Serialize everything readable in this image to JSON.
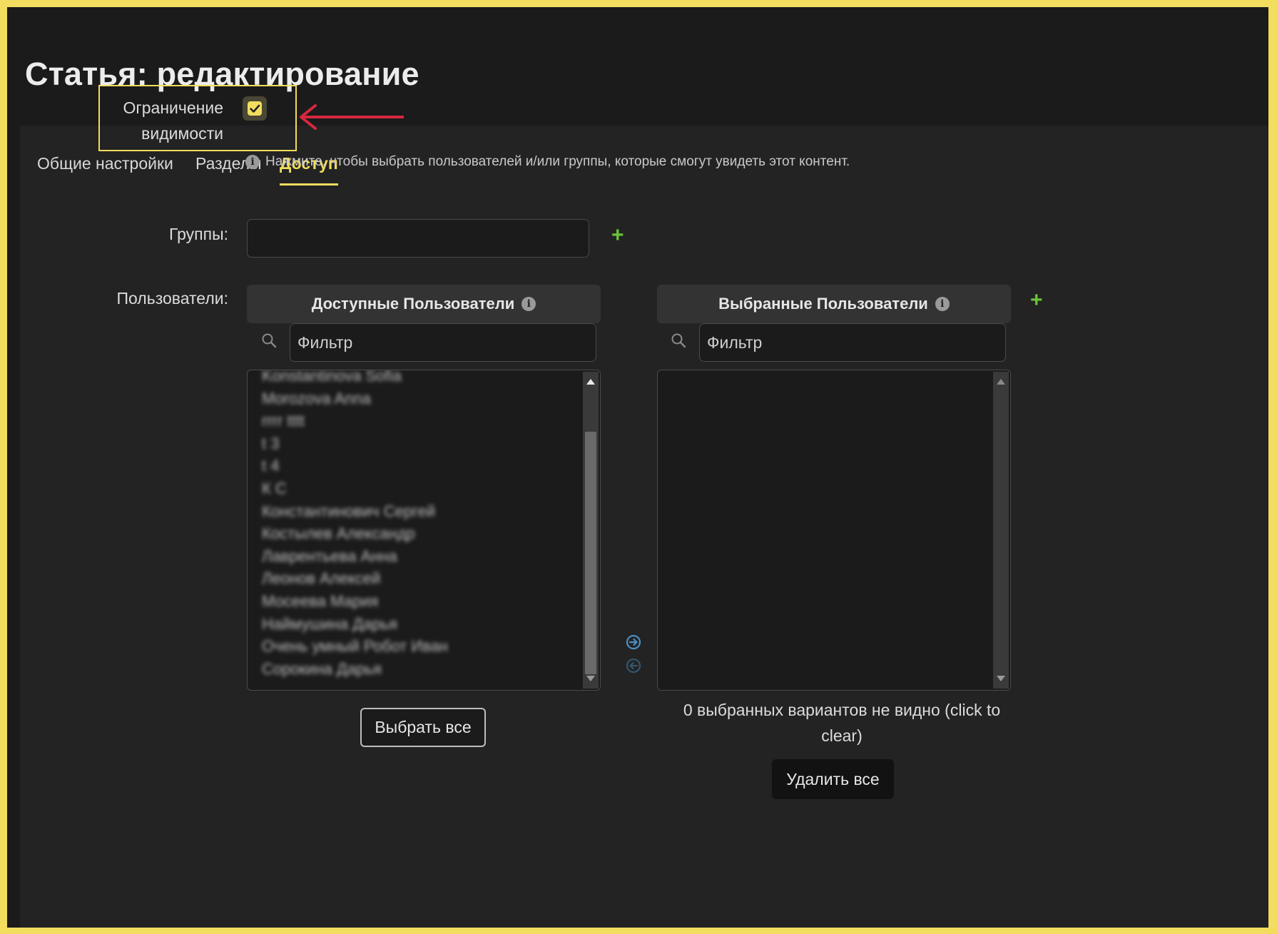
{
  "page": {
    "title": "Статья: редактирование"
  },
  "tabs": [
    {
      "label": "Общие настройки",
      "active": false
    },
    {
      "label": "Разделы",
      "active": false
    },
    {
      "label": "Доступ",
      "active": true
    }
  ],
  "visibility": {
    "label": "Ограничение видимости",
    "checked": true,
    "help": "Нажмите, чтобы выбрать пользователей и/или группы, которые смогут увидеть этот контент."
  },
  "groups": {
    "label": "Группы:",
    "value": ""
  },
  "users": {
    "label": "Пользователи:",
    "available": {
      "header": "Доступные Пользователи",
      "filter_placeholder": "Фильтр",
      "items": [
        "Konstantinova Sofia",
        "Morozova Anna",
        "rrrr tttt",
        "t 3",
        "t 4",
        "К С",
        "Константинович Сергей",
        "Костылев Александр",
        "Лаврентьева Анна",
        "Леонов Алексей",
        "Мосеева Мария",
        "Наймушина Дарья",
        "Очень умный Робот Иван",
        "Сорокина Дарья"
      ],
      "select_all_label": "Выбрать все"
    },
    "selected": {
      "header": "Выбранные Пользователи",
      "filter_placeholder": "Фильтр",
      "items": [],
      "hidden_note": "0 выбранных вариантов не видно (click to clear)",
      "remove_all_label": "Удалить все"
    }
  },
  "colors": {
    "accent": "#f2dd5f",
    "add": "#6cc33a",
    "move": "#4a8fc4",
    "annotation_arrow": "#d6283f"
  },
  "icons": {
    "checkbox": "check-icon",
    "info": "info-icon",
    "add": "plus-icon",
    "search": "search-icon",
    "move_right": "arrow-right-circle-icon",
    "move_left": "arrow-left-circle-icon"
  }
}
